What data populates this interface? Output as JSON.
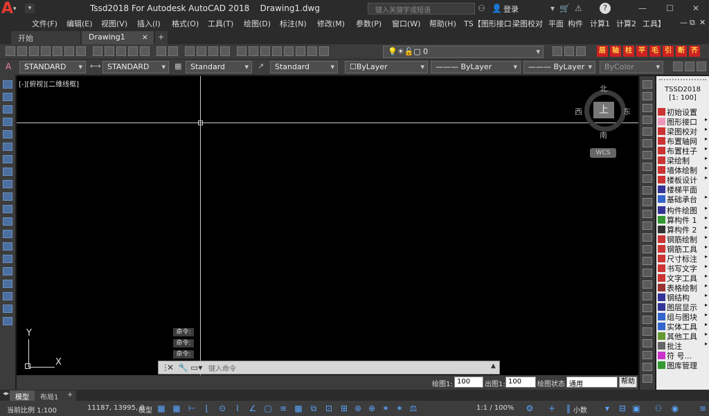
{
  "app": {
    "logo": "A",
    "title": "Tssd2018 For Autodesk AutoCAD 2018",
    "filename": "Drawing1.dwg",
    "search_placeholder": "键入关键字或短语",
    "login": "登录",
    "help": "?"
  },
  "menu": [
    "文件(F)",
    "编辑(E)",
    "视图(V)",
    "插入(I)",
    "格式(O)",
    "工具(T)",
    "绘图(D)",
    "标注(N)",
    "修改(M)",
    "参数(P)",
    "窗口(W)",
    "帮助(H)",
    "TS【图形接口",
    "梁图校对",
    "平面",
    "构件",
    "计算1",
    "计算2",
    "工具】"
  ],
  "tabs": {
    "start": "开始",
    "doc": "Drawing1",
    "close": "×",
    "add": "+"
  },
  "toolbar1": {
    "layer_value": "0",
    "ts_buttons": [
      "层",
      "轴",
      "柱",
      "平",
      "毛",
      "引",
      "断",
      "齐"
    ]
  },
  "toolbar2": {
    "textstyle": "STANDARD",
    "dimstyle": "STANDARD",
    "tablestyle": "Standard",
    "mleaderstyle": "Standard",
    "color": "ByLayer",
    "linetype": "ByLayer",
    "lineweight": "ByLayer",
    "plotstyle": "ByColor"
  },
  "viewport": {
    "label": "[-][俯视][二维线框]",
    "compass": {
      "n": "北",
      "s": "南",
      "e": "东",
      "w": "西",
      "top": "上"
    },
    "wcs": "WCS",
    "ucs_y": "Y",
    "ucs_x": "X"
  },
  "command": {
    "history": [
      "命令:",
      "命令:",
      "命令:"
    ],
    "placeholder": "键入命令"
  },
  "scalebar": {
    "draw_scale_label": "绘图1:",
    "draw_scale": "100",
    "out_scale_label": "出图1:",
    "out_scale": "100",
    "state_label": "绘图状态",
    "state": "通用",
    "help": "帮助"
  },
  "tssd": {
    "title": "TSSD2018",
    "scale": "[1: 100]",
    "items": [
      "初始设置",
      "图形接口",
      "梁图校对",
      "布置轴网",
      "布置柱子",
      "梁绘制",
      "墙体绘制",
      "楼板设计",
      "楼梯平面",
      "基础承台",
      "构件绘图",
      "算构件 1",
      "算构件 2",
      "钢筋绘制",
      "钢筋工具",
      "尺寸标注",
      "书写文字",
      "文字工具",
      "表格绘制",
      "钢结构",
      "图层显示",
      "组与图块",
      "实体工具",
      "其他工具",
      "批注",
      "符 号...",
      "图库管理"
    ],
    "arrows": [
      false,
      true,
      true,
      true,
      true,
      true,
      true,
      true,
      false,
      true,
      true,
      true,
      true,
      true,
      true,
      true,
      true,
      true,
      true,
      true,
      true,
      true,
      true,
      true,
      true,
      false,
      false
    ]
  },
  "layouts": {
    "model": "模型",
    "layout1": "布局1",
    "add": "+"
  },
  "status": {
    "scale": "当前比例 1:100",
    "coords": "11187, 13995, 0",
    "mode": "模型",
    "anno_scale": "1:1 / 100%",
    "decimal": "小数"
  },
  "colors": {
    "bg_canvas": "#000000",
    "accent_red": "#e63a2e",
    "ui_dark": "#2b2b2b",
    "ui_mid": "#3c3c3c"
  }
}
